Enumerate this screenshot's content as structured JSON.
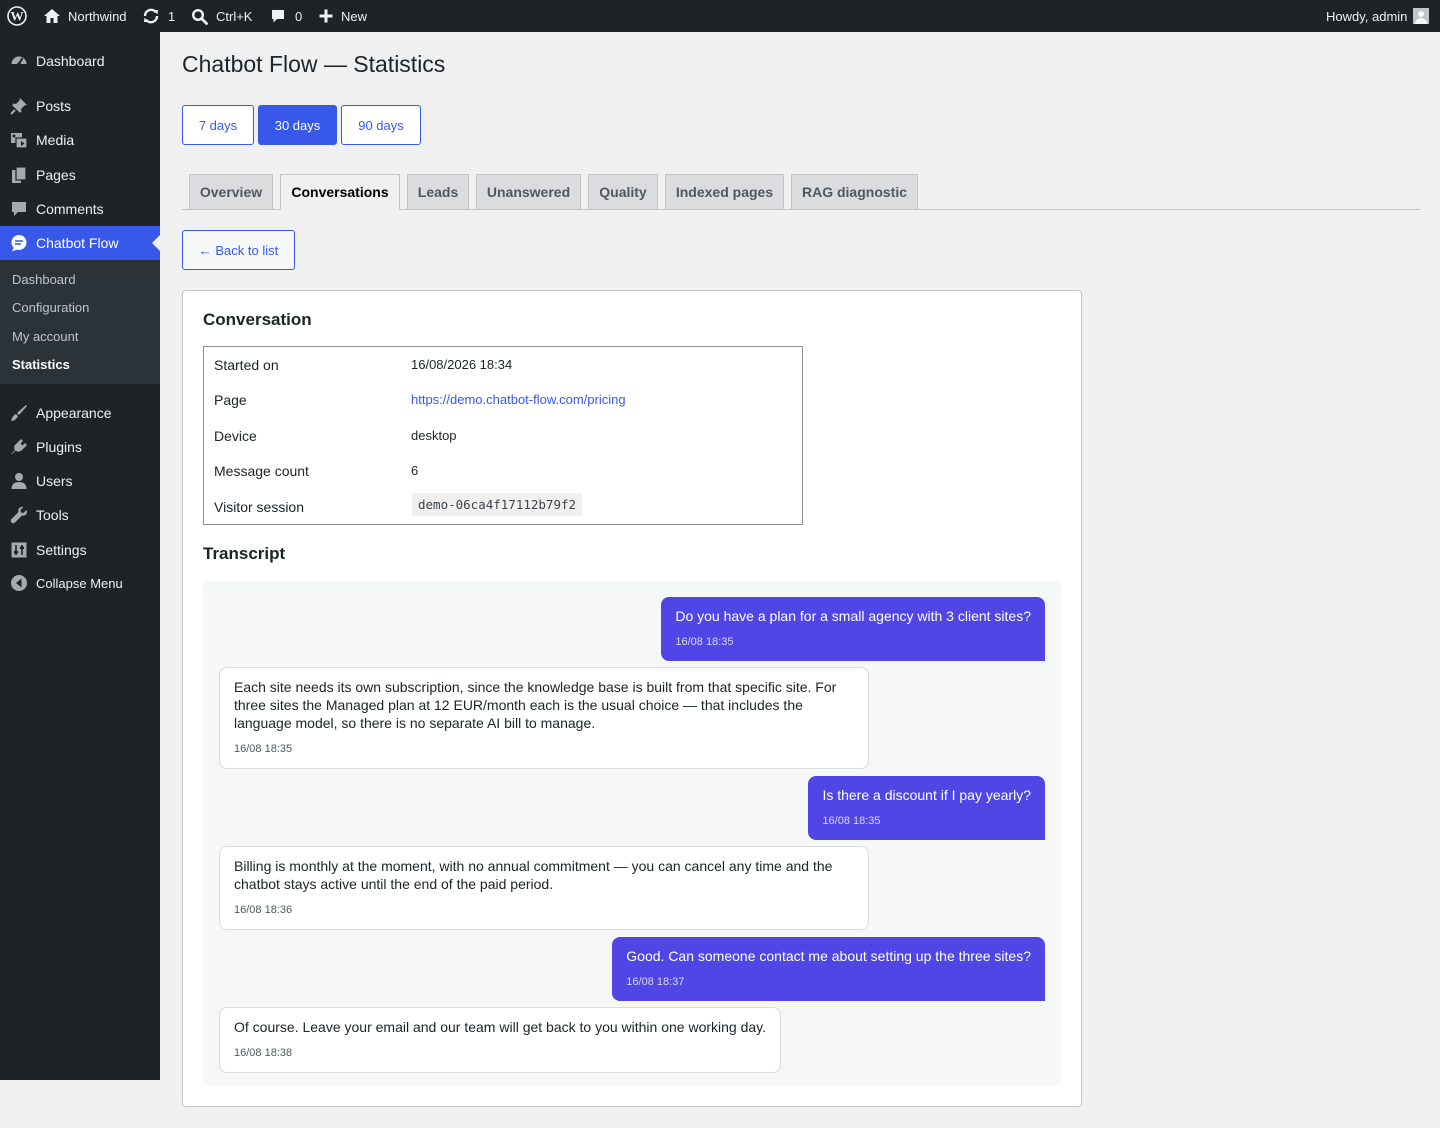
{
  "admin_bar": {
    "site_name": "Northwind",
    "updates_count": "1",
    "search_label": "Ctrl+K",
    "comments_count": "0",
    "new_label": "New",
    "howdy": "Howdy, admin"
  },
  "sidebar": {
    "items": [
      {
        "label": "Dashboard",
        "icon": "dashboard-icon"
      },
      {
        "label": "Posts",
        "icon": "pin-icon"
      },
      {
        "label": "Media",
        "icon": "media-icon"
      },
      {
        "label": "Pages",
        "icon": "pages-icon"
      },
      {
        "label": "Comments",
        "icon": "comment-icon"
      },
      {
        "label": "Chatbot Flow",
        "icon": "chat-icon"
      },
      {
        "label": "Appearance",
        "icon": "brush-icon"
      },
      {
        "label": "Plugins",
        "icon": "plugin-icon"
      },
      {
        "label": "Users",
        "icon": "user-icon"
      },
      {
        "label": "Tools",
        "icon": "wrench-icon"
      },
      {
        "label": "Settings",
        "icon": "settings-icon"
      },
      {
        "label": "Collapse Menu",
        "icon": "collapse-icon"
      }
    ],
    "submenu": [
      "Dashboard",
      "Configuration",
      "My account",
      "Statistics"
    ],
    "current": "Chatbot Flow",
    "current_sub": "Statistics",
    "accent_color": "#3858e9"
  },
  "page": {
    "title": "Chatbot Flow — Statistics",
    "ranges": [
      "7 days",
      "30 days",
      "90 days"
    ],
    "active_range": "30 days",
    "tabs": [
      "Overview",
      "Conversations",
      "Leads",
      "Unanswered",
      "Quality",
      "Indexed pages",
      "RAG diagnostic"
    ],
    "active_tab": "Conversations",
    "back_label": "← Back to list"
  },
  "conversation": {
    "heading": "Conversation",
    "rows": [
      {
        "label": "Started on",
        "value": "16/08/2026 18:34"
      },
      {
        "label": "Page",
        "value": "https://demo.chatbot-flow.com/pricing"
      },
      {
        "label": "Device",
        "value": "desktop"
      },
      {
        "label": "Message count",
        "value": "6"
      },
      {
        "label": "Visitor session",
        "value": "demo-06ca4f17112b79f2"
      }
    ]
  },
  "transcript": {
    "heading": "Transcript",
    "messages": [
      {
        "role": "user",
        "text": "Do you have a plan for a small agency with 3 client sites?",
        "time": "16/08 18:35"
      },
      {
        "role": "bot",
        "text": "Each site needs its own subscription, since the knowledge base is built from that specific site. For three sites the Managed plan at 12 EUR/month each is the usual choice — that includes the language model, so there is no separate AI bill to manage.",
        "time": "16/08 18:35"
      },
      {
        "role": "user",
        "text": "Is there a discount if I pay yearly?",
        "time": "16/08 18:35"
      },
      {
        "role": "bot",
        "text": "Billing is monthly at the moment, with no annual commitment — you can cancel any time and the chatbot stays active until the end of the paid period.",
        "time": "16/08 18:36"
      },
      {
        "role": "user",
        "text": "Good. Can someone contact me about setting up the three sites?",
        "time": "16/08 18:37"
      },
      {
        "role": "bot",
        "text": "Of course. Leave your email and our team will get back to you within one working day.",
        "time": "16/08 18:38"
      }
    ],
    "user_bubble_color": "#4f46e5"
  }
}
